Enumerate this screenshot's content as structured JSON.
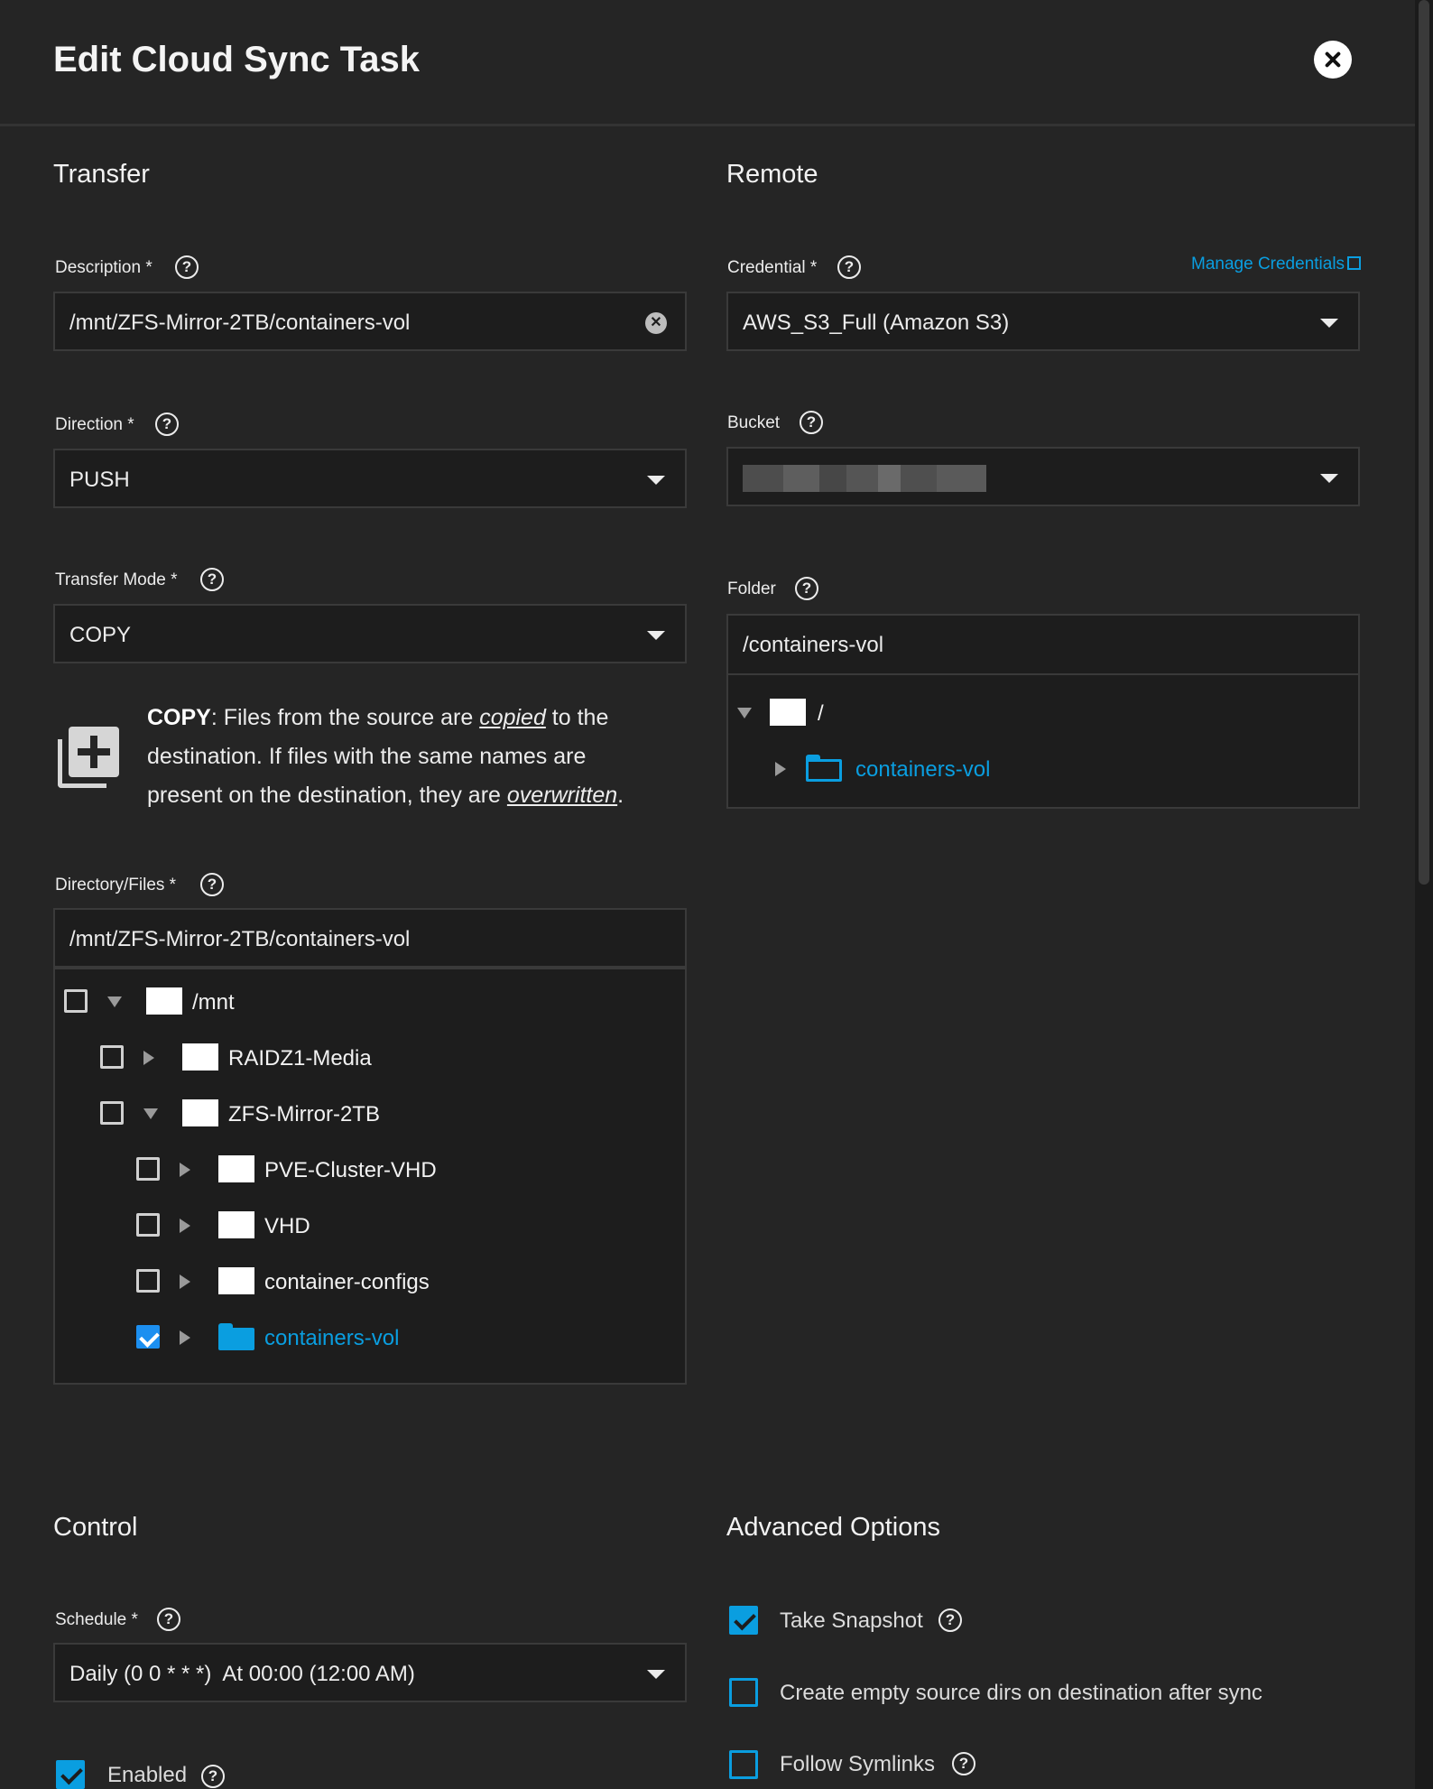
{
  "dialog": {
    "title": "Edit Cloud Sync Task"
  },
  "transfer": {
    "section_title": "Transfer",
    "description": {
      "label": "Description *",
      "value": "/mnt/ZFS-Mirror-2TB/containers-vol"
    },
    "direction": {
      "label": "Direction *",
      "value": "PUSH"
    },
    "transfer_mode": {
      "label": "Transfer Mode *",
      "value": "COPY"
    },
    "info": {
      "mode": "COPY",
      "p1": ": Files from the source are ",
      "copied": "copied",
      "p2": " to the destination. If files with the same names are present on the destination, they are ",
      "overwritten": "overwritten",
      "p3": "."
    },
    "directory_files": {
      "label": "Directory/Files *",
      "value": "/mnt/ZFS-Mirror-2TB/containers-vol",
      "tree": [
        {
          "name": "/mnt",
          "checked": false,
          "expanded": true
        },
        {
          "name": "RAIDZ1-Media",
          "checked": false,
          "expanded": false
        },
        {
          "name": "ZFS-Mirror-2TB",
          "checked": false,
          "expanded": true
        },
        {
          "name": "PVE-Cluster-VHD",
          "checked": false,
          "expanded": false
        },
        {
          "name": "VHD",
          "checked": false,
          "expanded": false
        },
        {
          "name": "container-configs",
          "checked": false,
          "expanded": false
        },
        {
          "name": "containers-vol",
          "checked": true,
          "expanded": false
        }
      ]
    }
  },
  "remote": {
    "section_title": "Remote",
    "credential": {
      "label": "Credential *",
      "value": "AWS_S3_Full (Amazon S3)"
    },
    "manage_credentials": "Manage Credentials",
    "bucket": {
      "label": "Bucket"
    },
    "folder": {
      "label": "Folder",
      "value": "/containers-vol",
      "tree": [
        {
          "name": "/",
          "expanded": true
        },
        {
          "name": "containers-vol",
          "expanded": false
        }
      ]
    }
  },
  "control": {
    "section_title": "Control",
    "schedule": {
      "label": "Schedule *",
      "value": "Daily (0 0 * * *)  At 00:00 (12:00 AM)"
    },
    "enabled": {
      "label": "Enabled",
      "checked": true
    }
  },
  "advanced": {
    "section_title": "Advanced Options",
    "take_snapshot": {
      "label": "Take Snapshot",
      "checked": true
    },
    "create_empty_dirs": {
      "label": "Create empty source dirs on destination after sync",
      "checked": false
    },
    "follow_symlinks": {
      "label": "Follow Symlinks",
      "checked": false
    }
  },
  "colors": {
    "accent": "#0a9ee0",
    "checkbox_accent": "#1c8ff0",
    "background": "#252525",
    "field_bg": "#1d1d1d"
  },
  "icons": [
    "close-icon",
    "help-icon",
    "clear-icon",
    "dropdown-caret-icon",
    "folder-icon",
    "expand-arrow-icon",
    "copy-mode-icon",
    "external-link-icon",
    "check-icon"
  ]
}
